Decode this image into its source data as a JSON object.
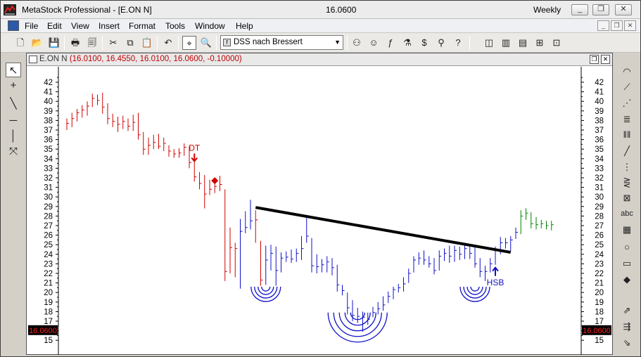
{
  "window": {
    "title": "MetaStock Professional - [E.ON N]",
    "price": "16.0600",
    "period": "Weekly",
    "controls": [
      "_",
      "❐",
      "✕"
    ]
  },
  "menu": {
    "items": [
      "File",
      "Edit",
      "View",
      "Insert",
      "Format",
      "Tools",
      "Window",
      "Help"
    ],
    "mdi_controls": [
      "_",
      "❐",
      "✕"
    ]
  },
  "toolbar": {
    "expert_select": "DSS nach Bressert"
  },
  "chart_window": {
    "symbol": "E.ON N",
    "values": "(16.0100, 16.4550, 16.0100, 16.0600, -0.10000)",
    "controls": [
      "❐",
      "✕"
    ]
  },
  "chart": {
    "current_price_label": "16.0600",
    "label_dt": "DT",
    "label_hsb": "HSB",
    "colors": {
      "down": "#d00000",
      "neutral": "#1010c8",
      "up": "#008000",
      "trendline": "#000000",
      "price_tag_bg": "#000000",
      "price_tag_fg": "#ff2020"
    }
  },
  "chart_data": {
    "type": "bar",
    "ylim": [
      14,
      43
    ],
    "y_ticks": [
      15,
      16,
      17,
      18,
      19,
      20,
      21,
      22,
      23,
      24,
      25,
      26,
      27,
      28,
      29,
      30,
      31,
      32,
      33,
      34,
      35,
      36,
      37,
      38,
      39,
      40,
      41,
      42
    ],
    "bars": [
      {
        "h": 38.2,
        "l": 37.0,
        "c": 37.7,
        "color": "red"
      },
      {
        "h": 38.8,
        "l": 37.3,
        "c": 38.2,
        "color": "red"
      },
      {
        "h": 39.2,
        "l": 37.9,
        "c": 38.8,
        "color": "red"
      },
      {
        "h": 39.6,
        "l": 38.3,
        "c": 39.1,
        "color": "red"
      },
      {
        "h": 40.0,
        "l": 38.5,
        "c": 39.5,
        "color": "red"
      },
      {
        "h": 40.8,
        "l": 39.4,
        "c": 40.3,
        "color": "red"
      },
      {
        "h": 40.7,
        "l": 39.6,
        "c": 40.1,
        "color": "red"
      },
      {
        "h": 40.9,
        "l": 38.7,
        "c": 39.4,
        "color": "red"
      },
      {
        "h": 39.8,
        "l": 37.6,
        "c": 38.2,
        "color": "red"
      },
      {
        "h": 38.7,
        "l": 37.3,
        "c": 37.9,
        "color": "red"
      },
      {
        "h": 38.4,
        "l": 36.8,
        "c": 37.6,
        "color": "red"
      },
      {
        "h": 38.5,
        "l": 37.1,
        "c": 37.9,
        "color": "red"
      },
      {
        "h": 38.2,
        "l": 36.9,
        "c": 37.4,
        "color": "red"
      },
      {
        "h": 38.6,
        "l": 36.9,
        "c": 37.8,
        "color": "red"
      },
      {
        "h": 38.8,
        "l": 36.0,
        "c": 36.5,
        "color": "red"
      },
      {
        "h": 36.8,
        "l": 34.4,
        "c": 35.0,
        "color": "red"
      },
      {
        "h": 36.2,
        "l": 34.4,
        "c": 35.4,
        "color": "red"
      },
      {
        "h": 36.5,
        "l": 35.0,
        "c": 35.7,
        "color": "red"
      },
      {
        "h": 36.6,
        "l": 35.0,
        "c": 35.3,
        "color": "red"
      },
      {
        "h": 36.2,
        "l": 34.8,
        "c": 35.6,
        "color": "red"
      },
      {
        "h": 35.4,
        "l": 34.2,
        "c": 34.8,
        "color": "red"
      },
      {
        "h": 35.0,
        "l": 34.1,
        "c": 34.5,
        "color": "red"
      },
      {
        "h": 35.1,
        "l": 34.1,
        "c": 34.6,
        "color": "red"
      },
      {
        "h": 35.6,
        "l": 34.3,
        "c": 35.2,
        "color": "red"
      },
      {
        "h": 35.3,
        "l": 33.0,
        "c": 33.6,
        "color": "red"
      },
      {
        "h": 34.1,
        "l": 31.6,
        "c": 32.1,
        "color": "red"
      },
      {
        "h": 32.6,
        "l": 30.8,
        "c": 31.4,
        "color": "red"
      },
      {
        "h": 32.3,
        "l": 28.8,
        "c": 30.3,
        "color": "red"
      },
      {
        "h": 31.8,
        "l": 30.2,
        "c": 30.8,
        "color": "red"
      },
      {
        "h": 31.6,
        "l": 30.4,
        "c": 31.1,
        "color": "red"
      },
      {
        "h": 32.2,
        "l": 30.6,
        "c": 31.3,
        "color": "red"
      },
      {
        "h": 30.8,
        "l": 21.2,
        "c": 22.2,
        "color": "red"
      },
      {
        "h": 26.8,
        "l": 22.0,
        "c": 24.7,
        "color": "red"
      },
      {
        "h": 25.2,
        "l": 21.6,
        "c": 24.6,
        "color": "red"
      },
      {
        "h": 27.7,
        "l": 20.4,
        "c": 26.4,
        "color": "blue"
      },
      {
        "h": 28.5,
        "l": 26.2,
        "c": 26.8,
        "color": "blue"
      },
      {
        "h": 29.7,
        "l": 26.6,
        "c": 27.5,
        "color": "blue"
      },
      {
        "h": 28.6,
        "l": 25.2,
        "c": 27.6,
        "color": "red"
      },
      {
        "h": 25.4,
        "l": 20.7,
        "c": 21.3,
        "color": "red"
      },
      {
        "h": 24.9,
        "l": 20.8,
        "c": 23.4,
        "color": "blue"
      },
      {
        "h": 25.0,
        "l": 22.3,
        "c": 24.1,
        "color": "blue"
      },
      {
        "h": 24.8,
        "l": 20.7,
        "c": 22.3,
        "color": "blue"
      },
      {
        "h": 24.2,
        "l": 22.1,
        "c": 23.6,
        "color": "blue"
      },
      {
        "h": 24.3,
        "l": 23.2,
        "c": 23.7,
        "color": "blue"
      },
      {
        "h": 24.5,
        "l": 23.1,
        "c": 23.5,
        "color": "blue"
      },
      {
        "h": 24.6,
        "l": 23.2,
        "c": 24.1,
        "color": "blue"
      },
      {
        "h": 25.9,
        "l": 23.4,
        "c": 24.6,
        "color": "blue"
      },
      {
        "h": 27.8,
        "l": 25.2,
        "c": 25.9,
        "color": "blue"
      },
      {
        "h": 25.7,
        "l": 22.1,
        "c": 22.8,
        "color": "blue"
      },
      {
        "h": 24.0,
        "l": 22.0,
        "c": 22.7,
        "color": "blue"
      },
      {
        "h": 23.5,
        "l": 22.1,
        "c": 22.9,
        "color": "blue"
      },
      {
        "h": 23.8,
        "l": 22.1,
        "c": 23.2,
        "color": "blue"
      },
      {
        "h": 23.6,
        "l": 21.8,
        "c": 22.6,
        "color": "blue"
      },
      {
        "h": 22.9,
        "l": 20.1,
        "c": 20.8,
        "color": "blue"
      },
      {
        "h": 20.8,
        "l": 19.7,
        "c": 20.2,
        "color": "blue"
      },
      {
        "h": 20.0,
        "l": 17.7,
        "c": 18.4,
        "color": "blue"
      },
      {
        "h": 19.2,
        "l": 17.0,
        "c": 17.6,
        "color": "blue"
      },
      {
        "h": 18.4,
        "l": 16.8,
        "c": 17.5,
        "color": "blue"
      },
      {
        "h": 18.0,
        "l": 15.9,
        "c": 17.4,
        "color": "blue"
      },
      {
        "h": 17.9,
        "l": 16.6,
        "c": 17.2,
        "color": "blue"
      },
      {
        "h": 18.5,
        "l": 17.4,
        "c": 17.9,
        "color": "blue"
      },
      {
        "h": 19.0,
        "l": 17.7,
        "c": 18.3,
        "color": "blue"
      },
      {
        "h": 19.6,
        "l": 18.1,
        "c": 18.7,
        "color": "blue"
      },
      {
        "h": 20.1,
        "l": 18.9,
        "c": 19.6,
        "color": "blue"
      },
      {
        "h": 20.6,
        "l": 19.3,
        "c": 20.3,
        "color": "blue"
      },
      {
        "h": 20.9,
        "l": 20.0,
        "c": 20.5,
        "color": "blue"
      },
      {
        "h": 21.6,
        "l": 20.1,
        "c": 20.9,
        "color": "blue"
      },
      {
        "h": 22.5,
        "l": 21.0,
        "c": 22.0,
        "color": "blue"
      },
      {
        "h": 23.8,
        "l": 22.1,
        "c": 23.4,
        "color": "blue"
      },
      {
        "h": 24.2,
        "l": 22.9,
        "c": 23.6,
        "color": "blue"
      },
      {
        "h": 24.4,
        "l": 22.9,
        "c": 23.4,
        "color": "blue"
      },
      {
        "h": 23.8,
        "l": 22.6,
        "c": 23.0,
        "color": "blue"
      },
      {
        "h": 23.6,
        "l": 21.9,
        "c": 22.3,
        "color": "blue"
      },
      {
        "h": 24.4,
        "l": 22.3,
        "c": 23.8,
        "color": "blue"
      },
      {
        "h": 24.6,
        "l": 23.3,
        "c": 24.1,
        "color": "blue"
      },
      {
        "h": 24.9,
        "l": 23.1,
        "c": 23.8,
        "color": "blue"
      },
      {
        "h": 24.9,
        "l": 23.2,
        "c": 24.4,
        "color": "blue"
      },
      {
        "h": 24.8,
        "l": 23.4,
        "c": 24.0,
        "color": "blue"
      },
      {
        "h": 25.1,
        "l": 23.5,
        "c": 24.6,
        "color": "blue"
      },
      {
        "h": 25.0,
        "l": 23.5,
        "c": 24.1,
        "color": "blue"
      },
      {
        "h": 24.8,
        "l": 22.6,
        "c": 23.0,
        "color": "blue"
      },
      {
        "h": 23.6,
        "l": 21.6,
        "c": 22.2,
        "color": "blue"
      },
      {
        "h": 22.8,
        "l": 21.2,
        "c": 22.2,
        "color": "blue"
      },
      {
        "h": 23.6,
        "l": 22.1,
        "c": 23.0,
        "color": "blue"
      },
      {
        "h": 24.8,
        "l": 22.9,
        "c": 24.5,
        "color": "blue"
      },
      {
        "h": 25.8,
        "l": 24.0,
        "c": 25.2,
        "color": "blue"
      },
      {
        "h": 25.7,
        "l": 24.6,
        "c": 25.2,
        "color": "blue"
      },
      {
        "h": 25.9,
        "l": 24.3,
        "c": 25.5,
        "color": "blue"
      },
      {
        "h": 26.8,
        "l": 25.6,
        "c": 26.3,
        "color": "blue"
      },
      {
        "h": 28.6,
        "l": 26.1,
        "c": 28.0,
        "color": "green"
      },
      {
        "h": 28.8,
        "l": 27.6,
        "c": 28.3,
        "color": "green"
      },
      {
        "h": 28.4,
        "l": 26.7,
        "c": 27.2,
        "color": "green"
      },
      {
        "h": 27.9,
        "l": 26.6,
        "c": 27.1,
        "color": "green"
      },
      {
        "h": 27.6,
        "l": 26.7,
        "c": 27.2,
        "color": "green"
      },
      {
        "h": 27.5,
        "l": 26.6,
        "c": 27.0,
        "color": "green"
      },
      {
        "h": 27.5,
        "l": 26.5,
        "c": 27.1,
        "color": "green"
      }
    ],
    "trendline": {
      "from_bar": 37,
      "from_y": 28.9,
      "to_bar": 87,
      "to_y": 24.2
    },
    "markers": {
      "dt_bar": 25,
      "diamond": {
        "bar": 29,
        "y": 31.7
      },
      "hsb_bar": 84,
      "arcs": [
        {
          "bar": 39,
          "y": 20.6,
          "rings": 4,
          "size": "small"
        },
        {
          "bar": 57,
          "y": 17.9,
          "rings": 5,
          "size": "large"
        },
        {
          "bar": 80,
          "y": 20.6,
          "rings": 4,
          "size": "small"
        }
      ]
    },
    "current_price": 16.06
  }
}
